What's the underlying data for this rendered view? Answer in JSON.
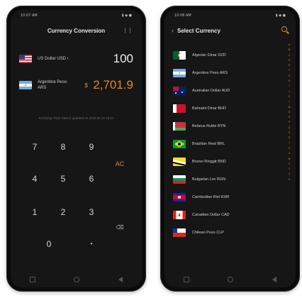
{
  "left_phone": {
    "status_time": "10:07 AM",
    "status_icons": "▮ ◆ ●",
    "title": "Currency Conversion",
    "from": {
      "flag": "us",
      "name": "US Dollar USD ›",
      "amount": "100"
    },
    "to": {
      "flag": "ar",
      "name": "Argentine Peso ARS",
      "prefix": "$",
      "amount": "2,701.9"
    },
    "note": "Exchange Rate Data is updated on 2018.05.10 18:31",
    "keys": {
      "k7": "7",
      "k8": "8",
      "k9": "9",
      "k4": "4",
      "k5": "5",
      "k6": "6",
      "k1": "1",
      "k2": "2",
      "k3": "3",
      "k0": "0",
      "dot": "•",
      "ac": "AC",
      "del": "⌫"
    }
  },
  "right_phone": {
    "status_time": "10:08 AM",
    "status_icons": "▮ ◆ ●",
    "title": "Select Currency",
    "items": [
      {
        "label": "Algerian Dinar DZD",
        "flag": "dz"
      },
      {
        "label": "Argentine Peso ARS",
        "flag": "ar"
      },
      {
        "label": "Australian Dollar AUD",
        "flag": "au"
      },
      {
        "label": "Bahraini Dinar BHD",
        "flag": "bh"
      },
      {
        "label": "Belarus Ruble BYN",
        "flag": "by"
      },
      {
        "label": "Brazilian Real BRL",
        "flag": "br"
      },
      {
        "label": "Brunei Ringgit BND",
        "flag": "bn"
      },
      {
        "label": "Bulgarian Lev BGN",
        "flag": "bg"
      },
      {
        "label": "Cambodian Riel KHR",
        "flag": "kh"
      },
      {
        "label": "Canadian Dollar CAD",
        "flag": "ca"
      },
      {
        "label": "Chilean Peso CLP",
        "flag": "cl"
      }
    ],
    "az_index": [
      "A",
      "B",
      "C",
      "D",
      "E",
      "F",
      "G",
      "H",
      "I",
      "J",
      "K",
      "L",
      "M",
      "N",
      "O",
      "P",
      "Q",
      "R",
      "S",
      "T",
      "U",
      "V",
      "W",
      "X",
      "Y",
      "Z",
      "#"
    ]
  }
}
